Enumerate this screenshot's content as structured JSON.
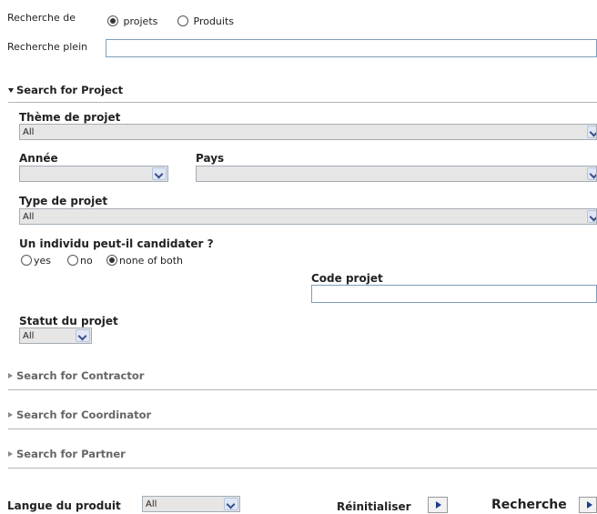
{
  "search_type": {
    "label": "Recherche de",
    "options": [
      "projets",
      "Produits"
    ],
    "selected": "projets"
  },
  "fulltext": {
    "label": "Recherche plein",
    "value": ""
  },
  "project_section": {
    "title": "Search for Project"
  },
  "theme": {
    "label": "Thème de projet",
    "value": "All"
  },
  "year": {
    "label": "Année",
    "value": ""
  },
  "country": {
    "label": "Pays",
    "value": ""
  },
  "project_type": {
    "label": "Type de projet",
    "value": "All"
  },
  "individual": {
    "label": "Un individu peut-il candidater ?",
    "options": [
      "yes",
      "no",
      "none of both"
    ],
    "selected": "none of both"
  },
  "project_code": {
    "label": "Code projet",
    "value": ""
  },
  "status": {
    "label": "Statut du projet",
    "value": "All"
  },
  "collapsed_sections": [
    "Search for Contractor",
    "Search for Coordinator",
    "Search for Partner"
  ],
  "footer": {
    "product_language_label": "Langue du produit",
    "product_language_value": "All",
    "reset_label": "Réinitialiser",
    "search_label": "Recherche"
  }
}
